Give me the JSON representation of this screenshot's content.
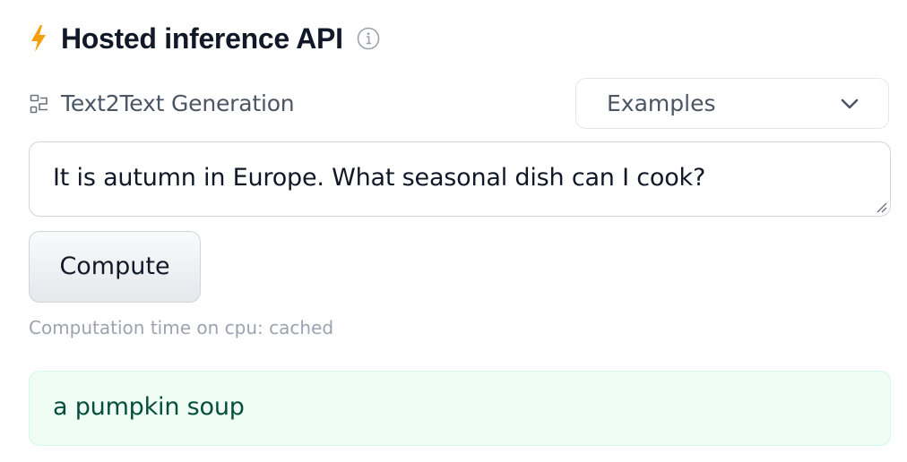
{
  "header": {
    "title": "Hosted inference API",
    "bolt_icon": "lightning-bolt-icon",
    "info_icon": "info-icon",
    "accent_color": "#f59e0b"
  },
  "task": {
    "label": "Text2Text Generation",
    "icon": "text2text-generation-icon"
  },
  "examples": {
    "label": "Examples",
    "icon": "chevron-down-icon"
  },
  "input": {
    "value": "It is autumn in Europe. What seasonal dish can I cook?"
  },
  "compute": {
    "label": "Compute"
  },
  "status": {
    "computation_time": "Computation time on cpu: cached"
  },
  "output": {
    "text": "a pumpkin soup",
    "background_color": "#effdf5"
  }
}
